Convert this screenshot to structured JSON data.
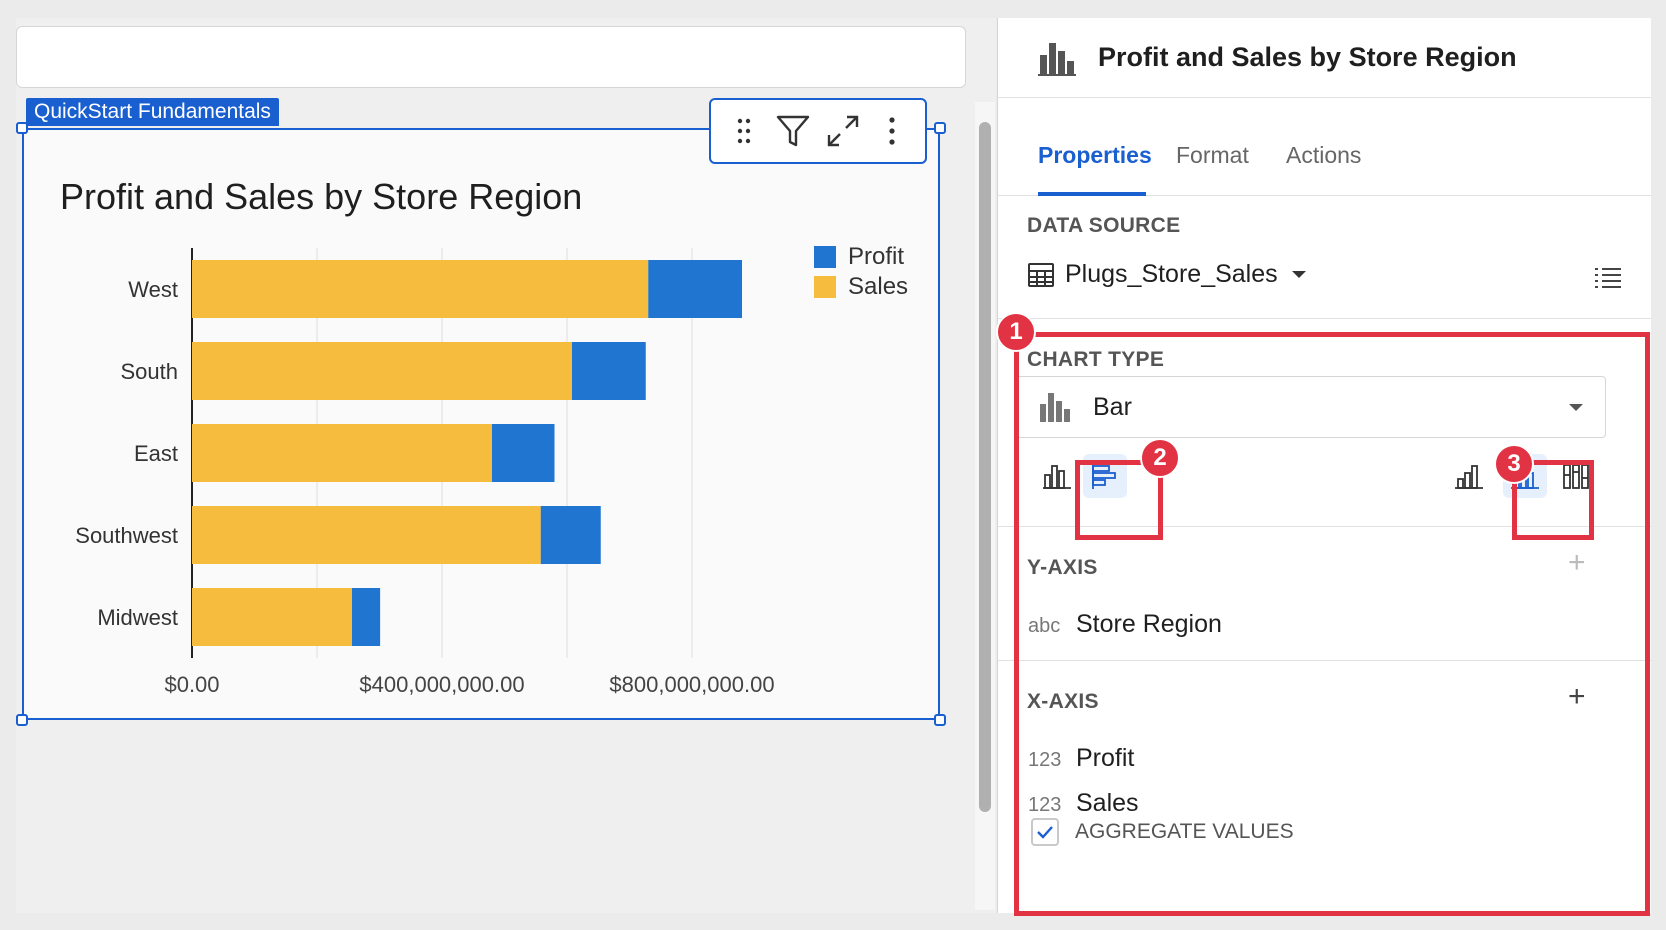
{
  "element": {
    "tag": "QuickStart Fundamentals"
  },
  "chart_data": {
    "type": "bar",
    "orientation": "horizontal",
    "stacked": true,
    "title": "Profit and Sales by Store Region",
    "categories": [
      "West",
      "South",
      "East",
      "Southwest",
      "Midwest"
    ],
    "series": [
      {
        "name": "Sales",
        "color": "#f5bc3e",
        "values": [
          730000000,
          608000000,
          480000000,
          558000000,
          256000000
        ]
      },
      {
        "name": "Profit",
        "color": "#1f75d0",
        "values": [
          150000000,
          118000000,
          100000000,
          96000000,
          45000000
        ]
      }
    ],
    "xlim": [
      0,
      1100000000
    ],
    "xticks": [
      0,
      400000000,
      800000000
    ],
    "xtick_labels": [
      "$0.00",
      "$400,000,000.00",
      "$800,000,000.00"
    ],
    "gridlines": [
      0,
      200000000,
      400000000,
      600000000,
      800000000
    ],
    "legend": [
      "Profit",
      "Sales"
    ],
    "legend_position": "top-right"
  },
  "panel": {
    "title": "Profit and Sales by Store Region",
    "tabs": [
      {
        "label": "Properties",
        "active": true
      },
      {
        "label": "Format",
        "active": false
      },
      {
        "label": "Actions",
        "active": false
      }
    ],
    "data_source_label": "DATA SOURCE",
    "data_source_name": "Plugs_Store_Sales",
    "chart_type_label": "CHART TYPE",
    "chart_type_value": "Bar",
    "y_axis_label": "Y-AXIS",
    "y_axis_fields": [
      {
        "type": "abc",
        "name": "Store Region"
      }
    ],
    "x_axis_label": "X-AXIS",
    "x_axis_fields": [
      {
        "type": "123",
        "name": "Profit"
      },
      {
        "type": "123",
        "name": "Sales"
      }
    ],
    "aggregate_label": "AGGREGATE VALUES",
    "aggregate_checked": true
  },
  "annotations": [
    "1",
    "2",
    "3"
  ],
  "colors": {
    "accent": "#1a5fd0",
    "annotation": "#e23344",
    "profit": "#1f75d0",
    "sales": "#f5bc3e"
  }
}
